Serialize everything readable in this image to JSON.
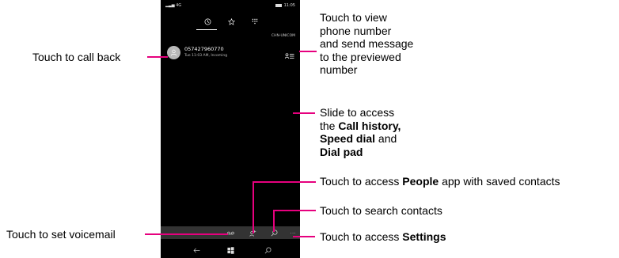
{
  "status": {
    "signal": "4G",
    "time": "11:05"
  },
  "carrier": "CHN-UNICOM",
  "call": {
    "number": "057427960770",
    "detail": "Tue 11:03 AM, Incoming"
  },
  "callouts": {
    "call_back": "Touch to call back",
    "view_number": [
      "Touch to view",
      "phone number",
      "and send message",
      "to the previewed",
      "number"
    ],
    "slide": {
      "line1": "Slide to access",
      "line2_pre": "the ",
      "call_history": "Call history,",
      "speed_dial": "Speed dial",
      "and": " and",
      "dial_pad": "Dial pad"
    },
    "people": {
      "pre": "Touch to access ",
      "bold": "People",
      "post": " app with saved contacts"
    },
    "search": "Touch to search contacts",
    "settings": {
      "pre": "Touch to access ",
      "bold": "Settings"
    },
    "voicemail": "Touch to set voicemail"
  },
  "appbar": {
    "more": "..."
  },
  "colors": {
    "accent": "#e6007e",
    "phone_bg": "#000000",
    "appbar_bg": "#333333"
  }
}
